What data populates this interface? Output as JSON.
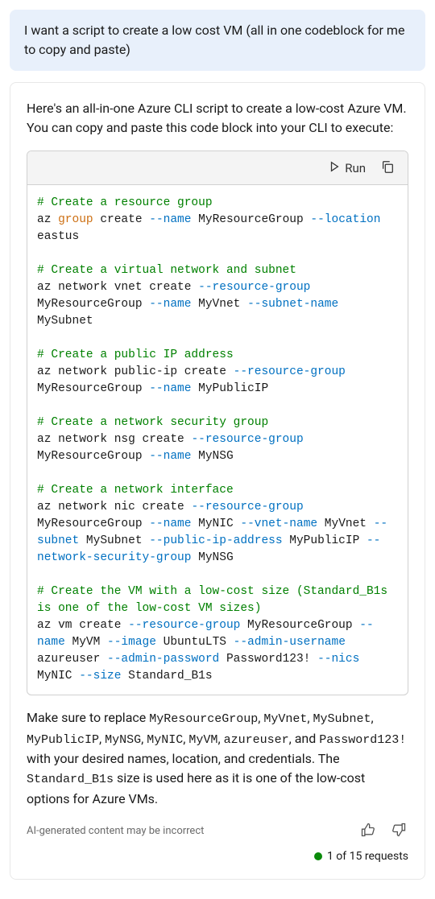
{
  "user_message": "I want a script to create a low cost VM (all in one codeblock for me to copy and paste)",
  "assistant_intro": "Here's an all-in-one Azure CLI script to create a low-cost Azure VM. You can copy and paste this code block into your CLI to execute:",
  "toolbar": {
    "run_label": "Run"
  },
  "code": {
    "c1": "# Create a resource group",
    "l1_a": "az ",
    "l1_b": "group",
    "l1_c": " create ",
    "l1_d": "--name",
    "l1_e": " MyResourceGroup ",
    "l1_f": "--location",
    "l1_g": " eastus",
    "c2": "# Create a virtual network and subnet",
    "l2_a": "az network vnet create ",
    "l2_b": "--resource-group",
    "l2_c": " MyResourceGroup ",
    "l2_d": "--name",
    "l2_e": " MyVnet ",
    "l2_f": "--subnet-name",
    "l2_g": " MySubnet",
    "c3": "# Create a public IP address",
    "l3_a": "az network public-ip create ",
    "l3_b": "--resource-group",
    "l3_c": " MyResourceGroup ",
    "l3_d": "--name",
    "l3_e": " MyPublicIP",
    "c4": "# Create a network security group",
    "l4_a": "az network nsg create ",
    "l4_b": "--resource-group",
    "l4_c": " MyResourceGroup ",
    "l4_d": "--name",
    "l4_e": " MyNSG",
    "c5": "# Create a network interface",
    "l5_a": "az network nic create ",
    "l5_b": "--resource-group",
    "l5_c": " MyResourceGroup ",
    "l5_d": "--name",
    "l5_e": " MyNIC ",
    "l5_f": "--vnet-name",
    "l5_g": " MyVnet ",
    "l5_h": "--subnet",
    "l5_i": " MySubnet ",
    "l5_j": "--public-ip-address",
    "l5_k": " MyPublicIP ",
    "l5_l": "--network-security-group",
    "l5_m": " MyNSG",
    "c6": "# Create the VM with a low-cost size (Standard_B1s is one of the low-cost VM sizes)",
    "l6_a": "az vm create ",
    "l6_b": "--resource-group",
    "l6_c": " MyResourceGroup ",
    "l6_d": "--name",
    "l6_e": " MyVM ",
    "l6_f": "--image",
    "l6_g": " UbuntuLTS ",
    "l6_h": "--admin-username",
    "l6_i": " azureuser ",
    "l6_j": "--admin-password",
    "l6_k": " Password123! ",
    "l6_l": "--nics",
    "l6_m": " MyNIC ",
    "l6_n": "--size",
    "l6_o": " Standard_B1s"
  },
  "outro": {
    "p1": "Make sure to replace ",
    "v1": "MyResourceGroup",
    "s1": ", ",
    "v2": "MyVnet",
    "s2": ", ",
    "v3": "MySubnet",
    "s3": ", ",
    "v4": "MyPublicIP",
    "s4": ", ",
    "v5": "MyNSG",
    "s5": ", ",
    "v6": "MyNIC",
    "s6": ", ",
    "v7": "MyVM",
    "s7": ", ",
    "v8": "azureuser",
    "s8": ", and ",
    "v9": "Password123!",
    "p2": " with your desired names, location, and credentials. The ",
    "v10": "Standard_B1s",
    "p3": " size is used here as it is one of the low-cost options for Azure VMs."
  },
  "disclaimer": "AI-generated content may be incorrect",
  "status": "1 of 15 requests"
}
